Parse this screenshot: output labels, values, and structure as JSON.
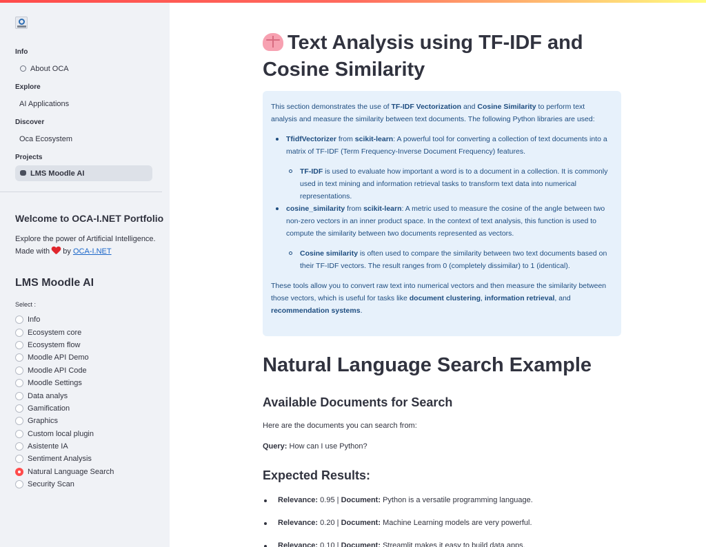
{
  "sidebar": {
    "nav": [
      {
        "heading": "Info",
        "items": [
          {
            "label": "About OCA",
            "icon": "person-icon"
          }
        ]
      },
      {
        "heading": "Explore",
        "items": [
          {
            "label": "AI Applications"
          }
        ]
      },
      {
        "heading": "Discover",
        "items": [
          {
            "label": "Oca Ecosystem"
          }
        ]
      },
      {
        "heading": "Projects",
        "items": [
          {
            "label": "LMS Moodle AI",
            "icon": "robot-icon",
            "active": true
          }
        ]
      }
    ],
    "welcome_title": "Welcome to OCA-I.NET Portfolio",
    "welcome_text_before": "Explore the power of Artificial Intelligence. Made with",
    "welcome_text_by": "by",
    "welcome_link": "OCA-I.NET",
    "section_title": "LMS Moodle AI",
    "select_label": "Select :",
    "options": [
      "Info",
      "Ecosystem core",
      "Ecosystem flow",
      "Moodle API Demo",
      "Moodle API Code",
      "Moodle Settings",
      "Data analys",
      "Gamification",
      "Graphics",
      "Custom local plugin",
      "Asistente IA",
      "Sentiment Analysis",
      "Natural Language Search",
      "Security Scan"
    ],
    "selected_option": "Natural Language Search"
  },
  "main": {
    "title": "Text Analysis using TF-IDF and Cosine Similarity",
    "info": {
      "intro_1": "This section demonstrates the use of",
      "intro_b1": "TF-IDF Vectorization",
      "intro_2": "and",
      "intro_b2": "Cosine Similarity",
      "intro_3": "to perform text analysis and measure the similarity between text documents. The following Python libraries are used:",
      "item1_b1": "TfidfVectorizer",
      "item1_from": "from",
      "item1_b2": "scikit-learn",
      "item1_text": ": A powerful tool for converting a collection of text documents into a matrix of TF-IDF (Term Frequency-Inverse Document Frequency) features.",
      "sub1_b": "TF-IDF",
      "sub1_text": "is used to evaluate how important a word is to a document in a collection. It is commonly used in text mining and information retrieval tasks to transform text data into numerical representations.",
      "item2_b1": "cosine_similarity",
      "item2_from": "from",
      "item2_b2": "scikit-learn",
      "item2_text": ": A metric used to measure the cosine of the angle between two non-zero vectors in an inner product space. In the context of text analysis, this function is used to compute the similarity between two documents represented as vectors.",
      "sub2_b": "Cosine similarity",
      "sub2_text": "is often used to compare the similarity between two text documents based on their TF-IDF vectors. The result ranges from 0 (completely dissimilar) to 1 (identical).",
      "outro_1": "These tools allow you to convert raw text into numerical vectors and then measure the similarity between those vectors, which is useful for tasks like",
      "outro_b1": "document clustering",
      "outro_b2": "information retrieval",
      "outro_2": ", and",
      "outro_b3": "recommendation systems",
      "outro_3": "."
    },
    "h2": "Natural Language Search Example",
    "h3_docs": "Available Documents for Search",
    "docs_text": "Here are the documents you can search from:",
    "query_label": "Query:",
    "query_value": "How can I use Python?",
    "h3_results": "Expected Results:",
    "results": [
      {
        "relevance": "0.95",
        "document": "Python is a versatile programming language."
      },
      {
        "relevance": "0.20",
        "document": "Machine Learning models are very powerful."
      },
      {
        "relevance": "0.10",
        "document": "Streamlit makes it easy to build data apps."
      }
    ],
    "relevance_label": "Relevance:",
    "document_label": "Document:",
    "separator": "|"
  }
}
